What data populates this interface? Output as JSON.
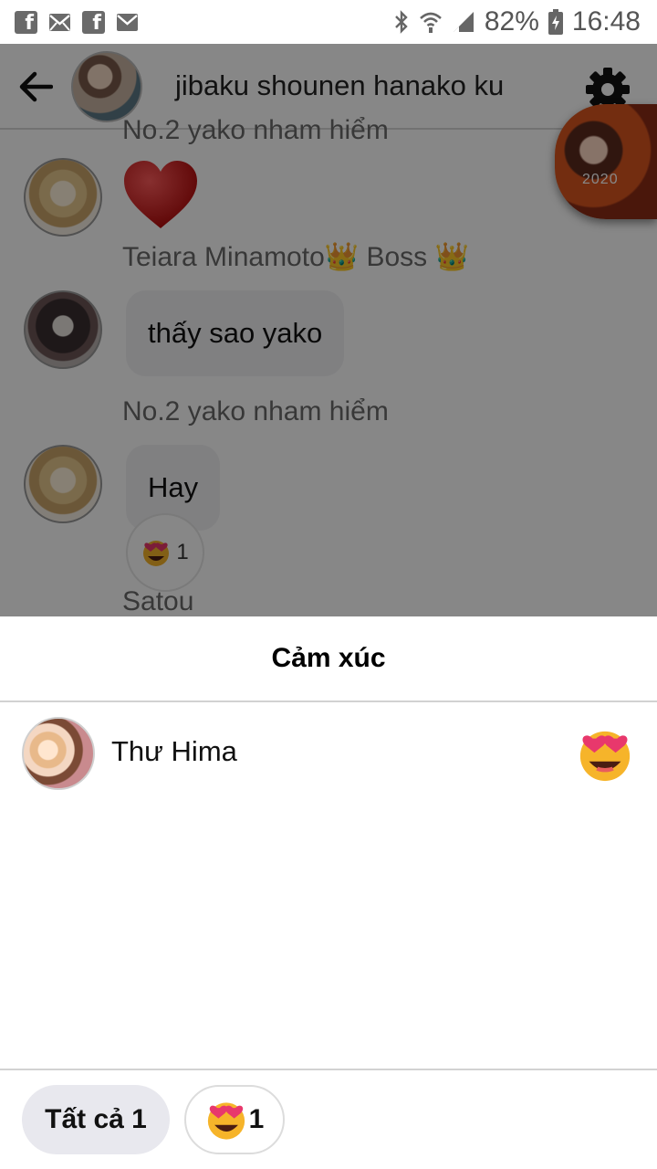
{
  "status_bar": {
    "battery": "82%",
    "time": "16:48",
    "icons": [
      "facebook-icon",
      "mail-icon",
      "facebook-icon",
      "mail-icon",
      "bluetooth-icon",
      "wifi-icon",
      "signal-icon",
      "battery-charging-icon"
    ]
  },
  "chat": {
    "title": "jibaku shounen hanako ku",
    "messages": [
      {
        "sender": "No.2 yako nham hiểm",
        "content_type": "heart-emoji"
      },
      {
        "sender": "Teiara Minamoto👑 Boss 👑",
        "text": "thấy sao yako"
      },
      {
        "sender": "No.2 yako nham hiểm",
        "text": "Hay",
        "reaction": {
          "emoji": "heart-eyes",
          "count": "1"
        }
      },
      {
        "sender": "Satou"
      }
    ]
  },
  "sheet": {
    "title": "Cảm xúc",
    "reactors": [
      {
        "name": "Thư Hima",
        "emoji": "heart-eyes"
      }
    ],
    "tabs": {
      "all_label": "Tất cả 1",
      "emoji_count": "1"
    }
  },
  "colors": {
    "overlay": "#000000",
    "bubble": "#f1f1f4",
    "tab_active_bg": "#e8e8ee"
  }
}
